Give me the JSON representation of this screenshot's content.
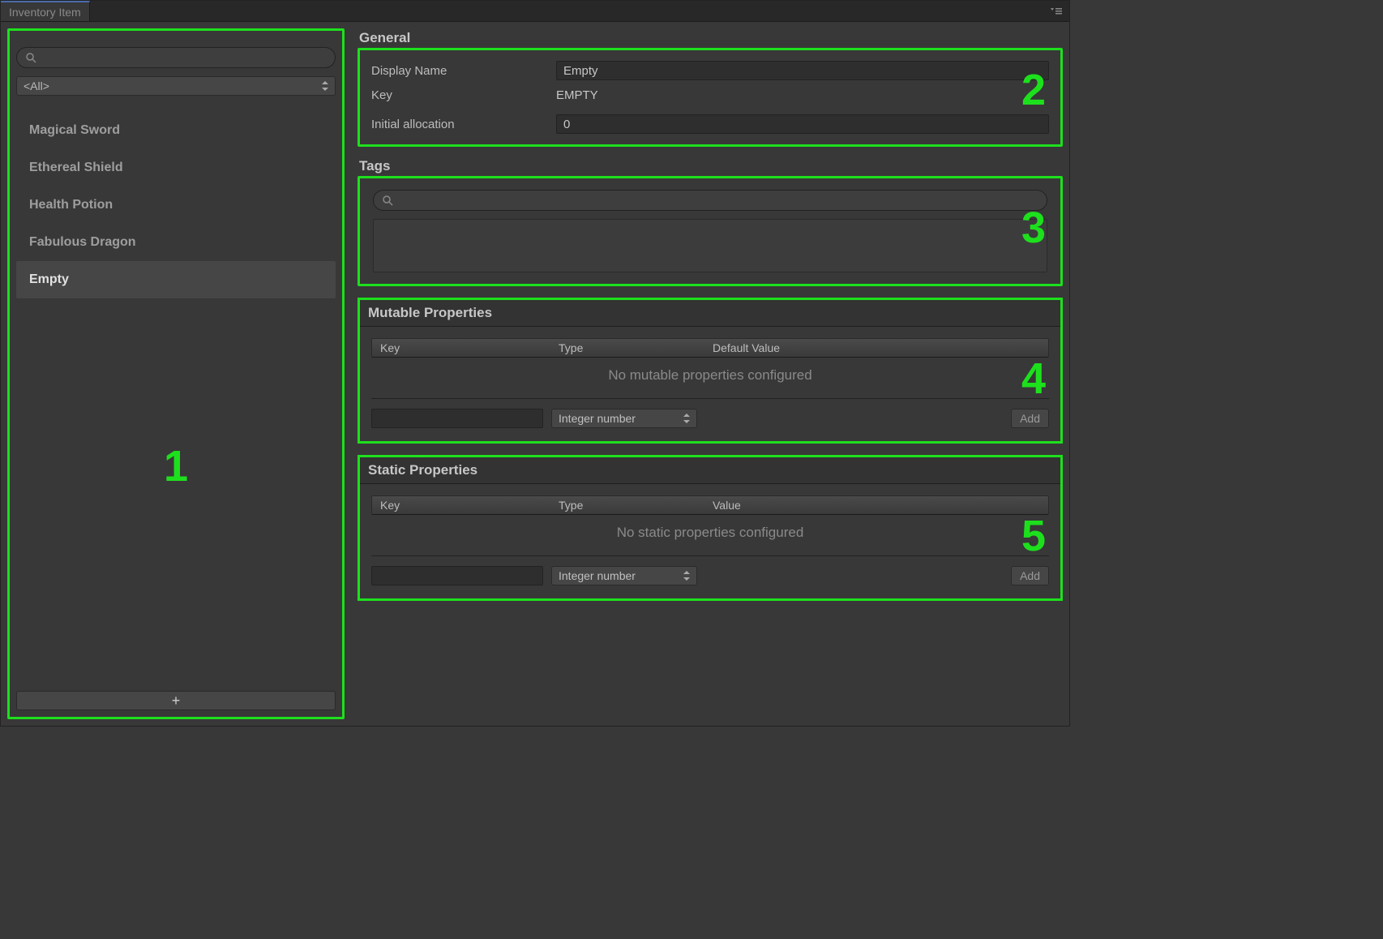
{
  "tab": {
    "title": "Inventory Item"
  },
  "highlights": {
    "h1": "1",
    "h2": "2",
    "h3": "3",
    "h4": "4",
    "h5": "5"
  },
  "sidebar": {
    "search_placeholder": "",
    "filter_label": "<All>",
    "items": [
      {
        "label": "Magical Sword",
        "selected": false
      },
      {
        "label": "Ethereal Shield",
        "selected": false
      },
      {
        "label": "Health Potion",
        "selected": false
      },
      {
        "label": "Fabulous Dragon",
        "selected": false
      },
      {
        "label": "Empty",
        "selected": true
      }
    ],
    "add_label": "+"
  },
  "general": {
    "title": "General",
    "display_name_label": "Display Name",
    "display_name_value": "Empty",
    "key_label": "Key",
    "key_value": "EMPTY",
    "initial_alloc_label": "Initial allocation",
    "initial_alloc_value": "0"
  },
  "tags": {
    "title": "Tags",
    "search_placeholder": ""
  },
  "mutable": {
    "title": "Mutable Properties",
    "col_key": "Key",
    "col_type": "Type",
    "col_value": "Default Value",
    "empty_text": "No mutable properties configured",
    "type_selected": "Integer number",
    "add_label": "Add"
  },
  "static": {
    "title": "Static Properties",
    "col_key": "Key",
    "col_type": "Type",
    "col_value": "Value",
    "empty_text": "No static properties configured",
    "type_selected": "Integer number",
    "add_label": "Add"
  }
}
